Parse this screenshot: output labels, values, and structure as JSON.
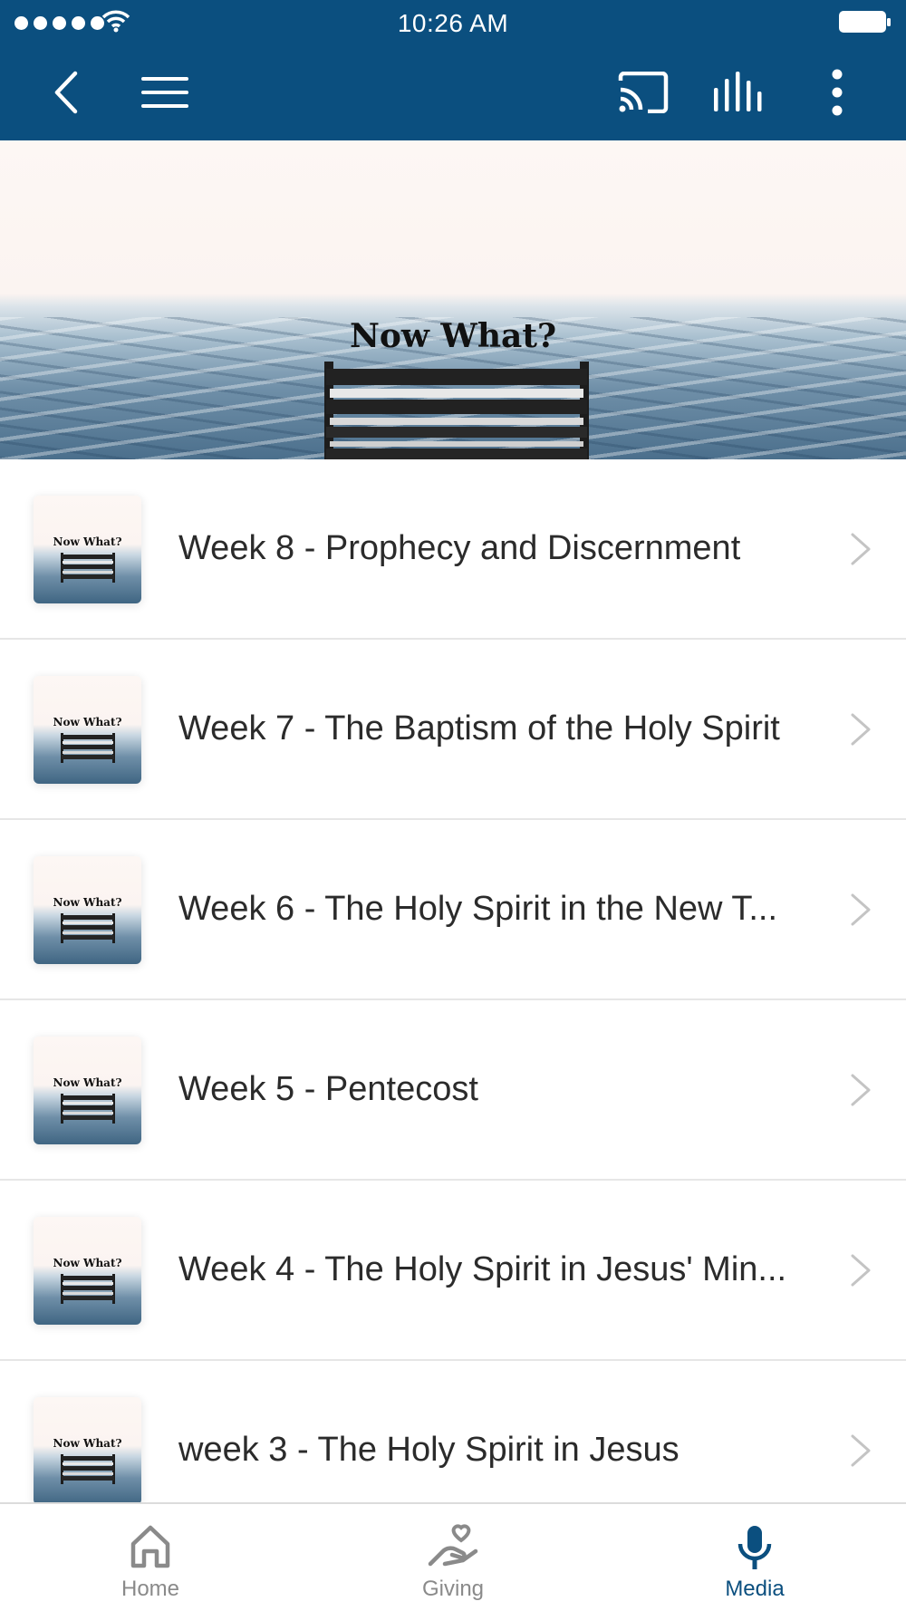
{
  "status_bar": {
    "time": "10:26 AM"
  },
  "hero": {
    "title": "Now What?"
  },
  "list": {
    "thumb_title": "Now What?",
    "items": [
      {
        "title": "Week 8 - Prophecy and Discernment"
      },
      {
        "title": "Week 7 - The Baptism of the Holy Spirit"
      },
      {
        "title": "Week 6 - The Holy Spirit in the New T..."
      },
      {
        "title": "Week 5 - Pentecost"
      },
      {
        "title": "Week 4 - The Holy Spirit in Jesus' Min..."
      },
      {
        "title": "week 3 - The Holy Spirit in Jesus"
      }
    ]
  },
  "tabs": [
    {
      "label": "Home",
      "icon": "home-icon",
      "active": false
    },
    {
      "label": "Giving",
      "icon": "giving-hand-heart-icon",
      "active": false
    },
    {
      "label": "Media",
      "icon": "microphone-icon",
      "active": true
    }
  ],
  "colors": {
    "brand": "#0b4f7f",
    "tab_inactive": "#8a8a8a",
    "text": "#2b2b2b"
  }
}
